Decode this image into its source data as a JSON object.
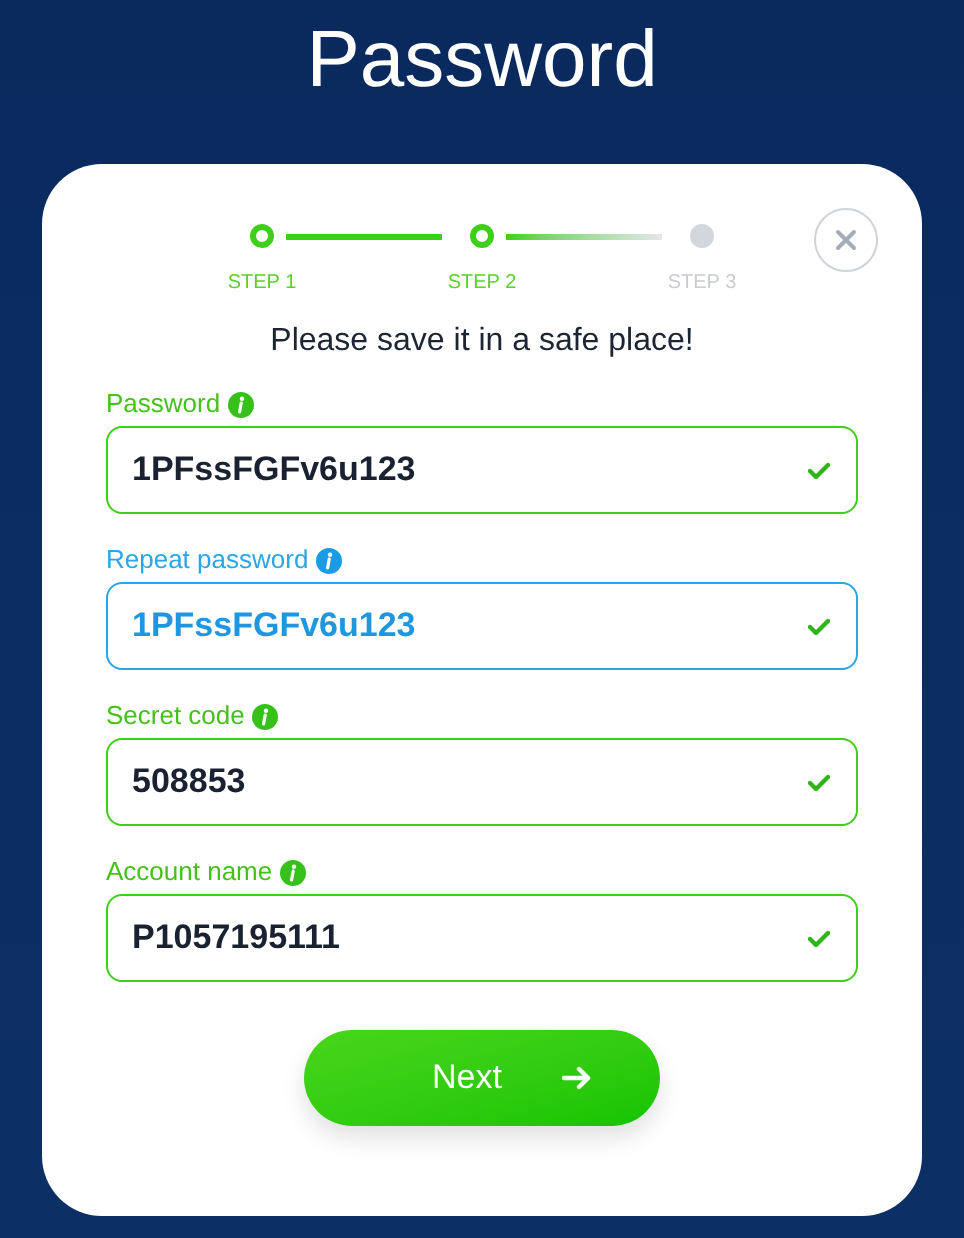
{
  "title": "Password",
  "steps": [
    {
      "label": "STEP 1",
      "completed": true
    },
    {
      "label": "STEP 2",
      "completed": true
    },
    {
      "label": "STEP 3",
      "completed": false
    }
  ],
  "message": "Please save it in a safe place!",
  "fields": [
    {
      "label": "Password",
      "value": "1PFssFGFv6u123",
      "focused": false,
      "valid": true
    },
    {
      "label": "Repeat password",
      "value": "1PFssFGFv6u123",
      "focused": true,
      "valid": true
    },
    {
      "label": "Secret code",
      "value": "508853",
      "focused": false,
      "valid": true
    },
    {
      "label": "Account name",
      "value": "P1057195111",
      "focused": false,
      "valid": true
    }
  ],
  "next_button": "Next"
}
